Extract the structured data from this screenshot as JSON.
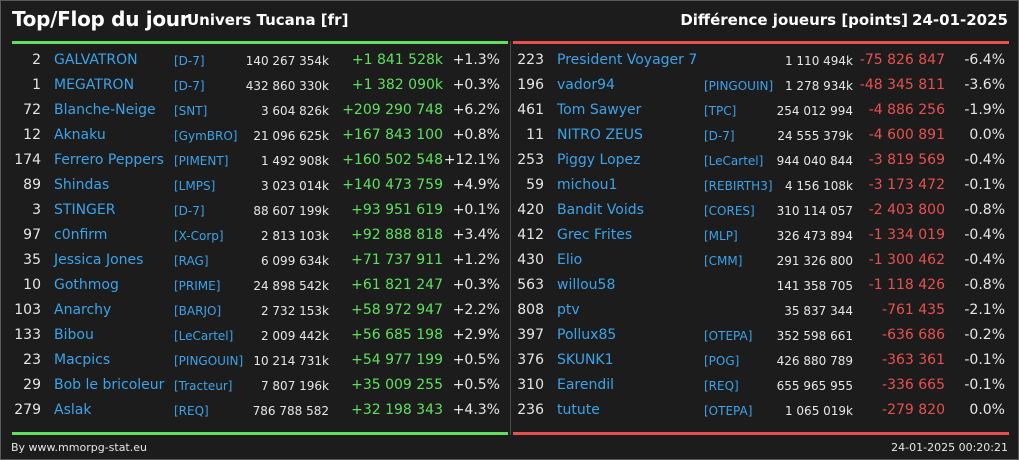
{
  "header": {
    "title": "Top/Flop du jour",
    "universe": "Univers Tucana [fr]",
    "metric": "Différence joueurs [points]",
    "date": "24-01-2025"
  },
  "colors": {
    "positive": "#5ee05e",
    "negative": "#e85050",
    "link": "#3aa3ea",
    "background": "#1c1c1c"
  },
  "top": [
    {
      "rank": "2",
      "name": "GALVATRON",
      "guild": "[D-7]",
      "total": "140 267 354k",
      "diff": "+1 841 528k",
      "pct": "+1.3%"
    },
    {
      "rank": "1",
      "name": "MEGATRON",
      "guild": "[D-7]",
      "total": "432 860 330k",
      "diff": "+1 382 090k",
      "pct": "+0.3%"
    },
    {
      "rank": "72",
      "name": "Blanche-Neige",
      "guild": "[SNT]",
      "total": "3 604 826k",
      "diff": "+209 290 748",
      "pct": "+6.2%"
    },
    {
      "rank": "12",
      "name": "Aknaku",
      "guild": "[GymBRO]",
      "total": "21 096 625k",
      "diff": "+167 843 100",
      "pct": "+0.8%"
    },
    {
      "rank": "174",
      "name": "Ferrero Peppers",
      "guild": "[PIMENT]",
      "total": "1 492 908k",
      "diff": "+160 502 548",
      "pct": "+12.1%"
    },
    {
      "rank": "89",
      "name": "Shindas",
      "guild": "[LMPS]",
      "total": "3 023 014k",
      "diff": "+140 473 759",
      "pct": "+4.9%"
    },
    {
      "rank": "3",
      "name": "STINGER",
      "guild": "[D-7]",
      "total": "88 607 199k",
      "diff": "+93 951 619",
      "pct": "+0.1%"
    },
    {
      "rank": "97",
      "name": "c0nfirm",
      "guild": "[X-Corp]",
      "total": "2 813 103k",
      "diff": "+92 888 818",
      "pct": "+3.4%"
    },
    {
      "rank": "35",
      "name": "Jessica Jones",
      "guild": "[RAG]",
      "total": "6 099 634k",
      "diff": "+71 737 911",
      "pct": "+1.2%"
    },
    {
      "rank": "10",
      "name": "Gothmog",
      "guild": "[PRIME]",
      "total": "24 898 542k",
      "diff": "+61 821 247",
      "pct": "+0.3%"
    },
    {
      "rank": "103",
      "name": "Anarchy",
      "guild": "[BARJO]",
      "total": "2 732 153k",
      "diff": "+58 972 947",
      "pct": "+2.2%"
    },
    {
      "rank": "133",
      "name": "Bibou",
      "guild": "[LeCartel]",
      "total": "2 009 442k",
      "diff": "+56 685 198",
      "pct": "+2.9%"
    },
    {
      "rank": "23",
      "name": "Macpics",
      "guild": "[PINGOUIN]",
      "total": "10 214 731k",
      "diff": "+54 977 199",
      "pct": "+0.5%"
    },
    {
      "rank": "29",
      "name": "Bob le bricoleur",
      "guild": "[Tracteur]",
      "total": "7 807 196k",
      "diff": "+35 009 255",
      "pct": "+0.5%"
    },
    {
      "rank": "279",
      "name": "Aslak",
      "guild": "[REQ]",
      "total": "786 788 582",
      "diff": "+32 198 343",
      "pct": "+4.3%"
    }
  ],
  "flop": [
    {
      "rank": "223",
      "name": "President Voyager 7",
      "guild": "",
      "total": "1 110 494k",
      "diff": "-75 826 847",
      "pct": "-6.4%"
    },
    {
      "rank": "196",
      "name": "vador94",
      "guild": "[PINGOUIN]",
      "total": "1 278 934k",
      "diff": "-48 345 811",
      "pct": "-3.6%"
    },
    {
      "rank": "461",
      "name": "Tom Sawyer",
      "guild": "[TPC]",
      "total": "254 012 994",
      "diff": "-4 886 256",
      "pct": "-1.9%"
    },
    {
      "rank": "11",
      "name": "NITRO ZEUS",
      "guild": "[D-7]",
      "total": "24 555 379k",
      "diff": "-4 600 891",
      "pct": "0.0%"
    },
    {
      "rank": "253",
      "name": "Piggy Lopez",
      "guild": "[LeCartel]",
      "total": "944 040 844",
      "diff": "-3 819 569",
      "pct": "-0.4%"
    },
    {
      "rank": "59",
      "name": "michou1",
      "guild": "[REBIRTH3]",
      "total": "4 156 108k",
      "diff": "-3 173 472",
      "pct": "-0.1%"
    },
    {
      "rank": "420",
      "name": "Bandit Voids",
      "guild": "[CORES]",
      "total": "310 114 057",
      "diff": "-2 403 800",
      "pct": "-0.8%"
    },
    {
      "rank": "412",
      "name": "Grec Frites",
      "guild": "[MLP]",
      "total": "326 473 894",
      "diff": "-1 334 019",
      "pct": "-0.4%"
    },
    {
      "rank": "430",
      "name": "Elio",
      "guild": "[CMM]",
      "total": "291 326 800",
      "diff": "-1 300 462",
      "pct": "-0.4%"
    },
    {
      "rank": "563",
      "name": "willou58",
      "guild": "",
      "total": "141 358 705",
      "diff": "-1 118 426",
      "pct": "-0.8%"
    },
    {
      "rank": "808",
      "name": "ptv",
      "guild": "",
      "total": "35 837 344",
      "diff": "-761 435",
      "pct": "-2.1%"
    },
    {
      "rank": "397",
      "name": "Pollux85",
      "guild": "[OTEPA]",
      "total": "352 598 661",
      "diff": "-636 686",
      "pct": "-0.2%"
    },
    {
      "rank": "376",
      "name": "SKUNK1",
      "guild": "[POG]",
      "total": "426 880 789",
      "diff": "-363 361",
      "pct": "-0.1%"
    },
    {
      "rank": "310",
      "name": "Earendil",
      "guild": "[REQ]",
      "total": "655 965 955",
      "diff": "-336 665",
      "pct": "-0.1%"
    },
    {
      "rank": "236",
      "name": "tutute",
      "guild": "[OTEPA]",
      "total": "1 065 019k",
      "diff": "-279 820",
      "pct": "0.0%"
    }
  ],
  "footer": {
    "source": "By www.mmorpg-stat.eu",
    "timestamp": "24-01-2025 00:20:21"
  }
}
